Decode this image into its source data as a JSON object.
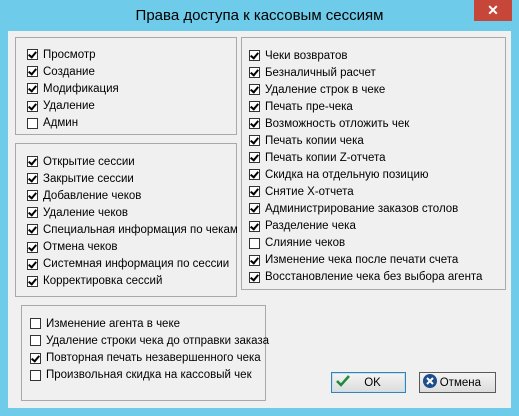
{
  "window": {
    "title": "Права доступа к кассовым сессиям",
    "close_label": "✕"
  },
  "group_basic": [
    {
      "label": "Просмотр",
      "checked": true
    },
    {
      "label": "Создание",
      "checked": true
    },
    {
      "label": "Модификация",
      "checked": true
    },
    {
      "label": "Удаление",
      "checked": true
    },
    {
      "label": "Админ",
      "checked": false
    }
  ],
  "group_session": [
    {
      "label": "Открытие сессии",
      "checked": true
    },
    {
      "label": "Закрытие сессии",
      "checked": true
    },
    {
      "label": "Добавление чеков",
      "checked": true
    },
    {
      "label": "Удаление чеков",
      "checked": true
    },
    {
      "label": "Специальная информация по чекам",
      "checked": true
    },
    {
      "label": "Отмена чеков",
      "checked": true
    },
    {
      "label": "Системная информация по сессии",
      "checked": true
    },
    {
      "label": "Корректировка сессий",
      "checked": true
    }
  ],
  "group_checks": [
    {
      "label": "Чеки возвратов",
      "checked": true
    },
    {
      "label": "Безналичный расчет",
      "checked": true
    },
    {
      "label": "Удаление строк в чеке",
      "checked": true
    },
    {
      "label": "Печать пре-чека",
      "checked": true
    },
    {
      "label": "Возможность отложить чек",
      "checked": true
    },
    {
      "label": "Печать копии чека",
      "checked": true
    },
    {
      "label": "Печать копии Z-отчета",
      "checked": true
    },
    {
      "label": "Скидка на отдельную позицию",
      "checked": true
    },
    {
      "label": "Снятие X-отчета",
      "checked": true
    },
    {
      "label": "Администрирование заказов столов",
      "checked": true
    },
    {
      "label": "Разделение чека",
      "checked": true
    },
    {
      "label": "Слияние чеков",
      "checked": false
    },
    {
      "label": "Изменение чека после печати счета",
      "checked": true
    },
    {
      "label": "Восстановление чека без выбора агента",
      "checked": true
    }
  ],
  "group_other": [
    {
      "label": "Изменение агента в чеке",
      "checked": false
    },
    {
      "label": "Удаление строки чека до отправки заказа",
      "checked": false
    },
    {
      "label": "Повторная печать незавершенного чека",
      "checked": true
    },
    {
      "label": "Произвольная скидка на кассовый чек",
      "checked": false
    }
  ],
  "buttons": {
    "ok_label": "OK",
    "cancel_label": "Отмена"
  },
  "colors": {
    "titlebar": "#6FCBEA",
    "close": "#C7463A",
    "ok_icon": "#1F8A3A",
    "cancel_icon": "#1C4E8C"
  }
}
